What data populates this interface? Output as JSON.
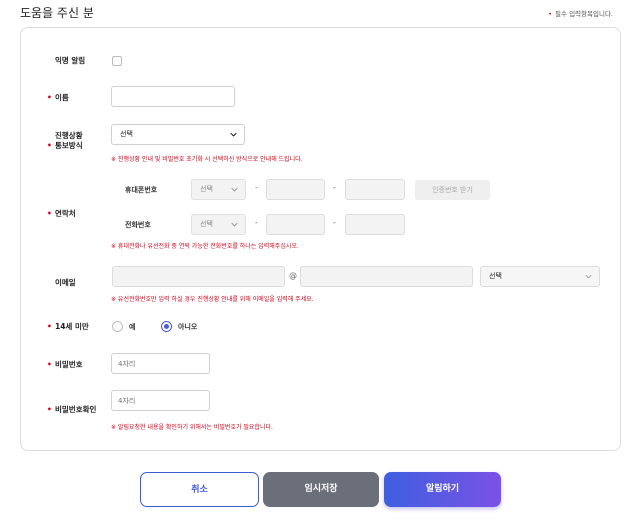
{
  "header": {
    "title": "도움을 주신 분",
    "required_note": "필수 입력항목입니다."
  },
  "form": {
    "anonymous": {
      "label": "익명 알림"
    },
    "name": {
      "label": "이름",
      "value": ""
    },
    "progress_notify": {
      "label_line1": "진행상황",
      "label_line2": "통보방식",
      "selected": "선택",
      "note": "※ 진행상황 안내 및 비밀번호 초기화 시 선택하신 방식으로 안내해 드립니다."
    },
    "contact": {
      "label": "연락처",
      "mobile_label": "휴대폰번호",
      "mobile_select": "선택",
      "verify_button": "인증번호 받기",
      "phone_label": "전화번호",
      "phone_select": "선택",
      "dash": "-",
      "note": "※ 휴대전화나 유선전화 중 연락 가능한 전화번호를 하나는 입력해주십시오."
    },
    "email": {
      "label": "이메일",
      "at": "@",
      "domain_select": "선택",
      "note": "※ 유선전화번호만 입력 하실 경우 진행상황 안내를 위해 이메일을 입력해 주세요."
    },
    "under14": {
      "label": "14세 미만",
      "option_yes": "예",
      "option_no": "아니오",
      "selected": "아니오"
    },
    "password": {
      "label": "비밀번호",
      "placeholder": "4자리"
    },
    "password_confirm": {
      "label": "비밀번호확인",
      "placeholder": "4자리",
      "note": "※ 알림요청한 내용을 확인하기 위해서는 비밀번호가 필요합니다."
    }
  },
  "buttons": {
    "cancel": "취소",
    "save_draft": "임시저장",
    "submit": "알림하기"
  },
  "colors": {
    "required_dot": "#d0021b",
    "accent": "#3e5bd6",
    "submit_gradient_end": "#7a52e6",
    "save_button": "#6b6f7a"
  }
}
